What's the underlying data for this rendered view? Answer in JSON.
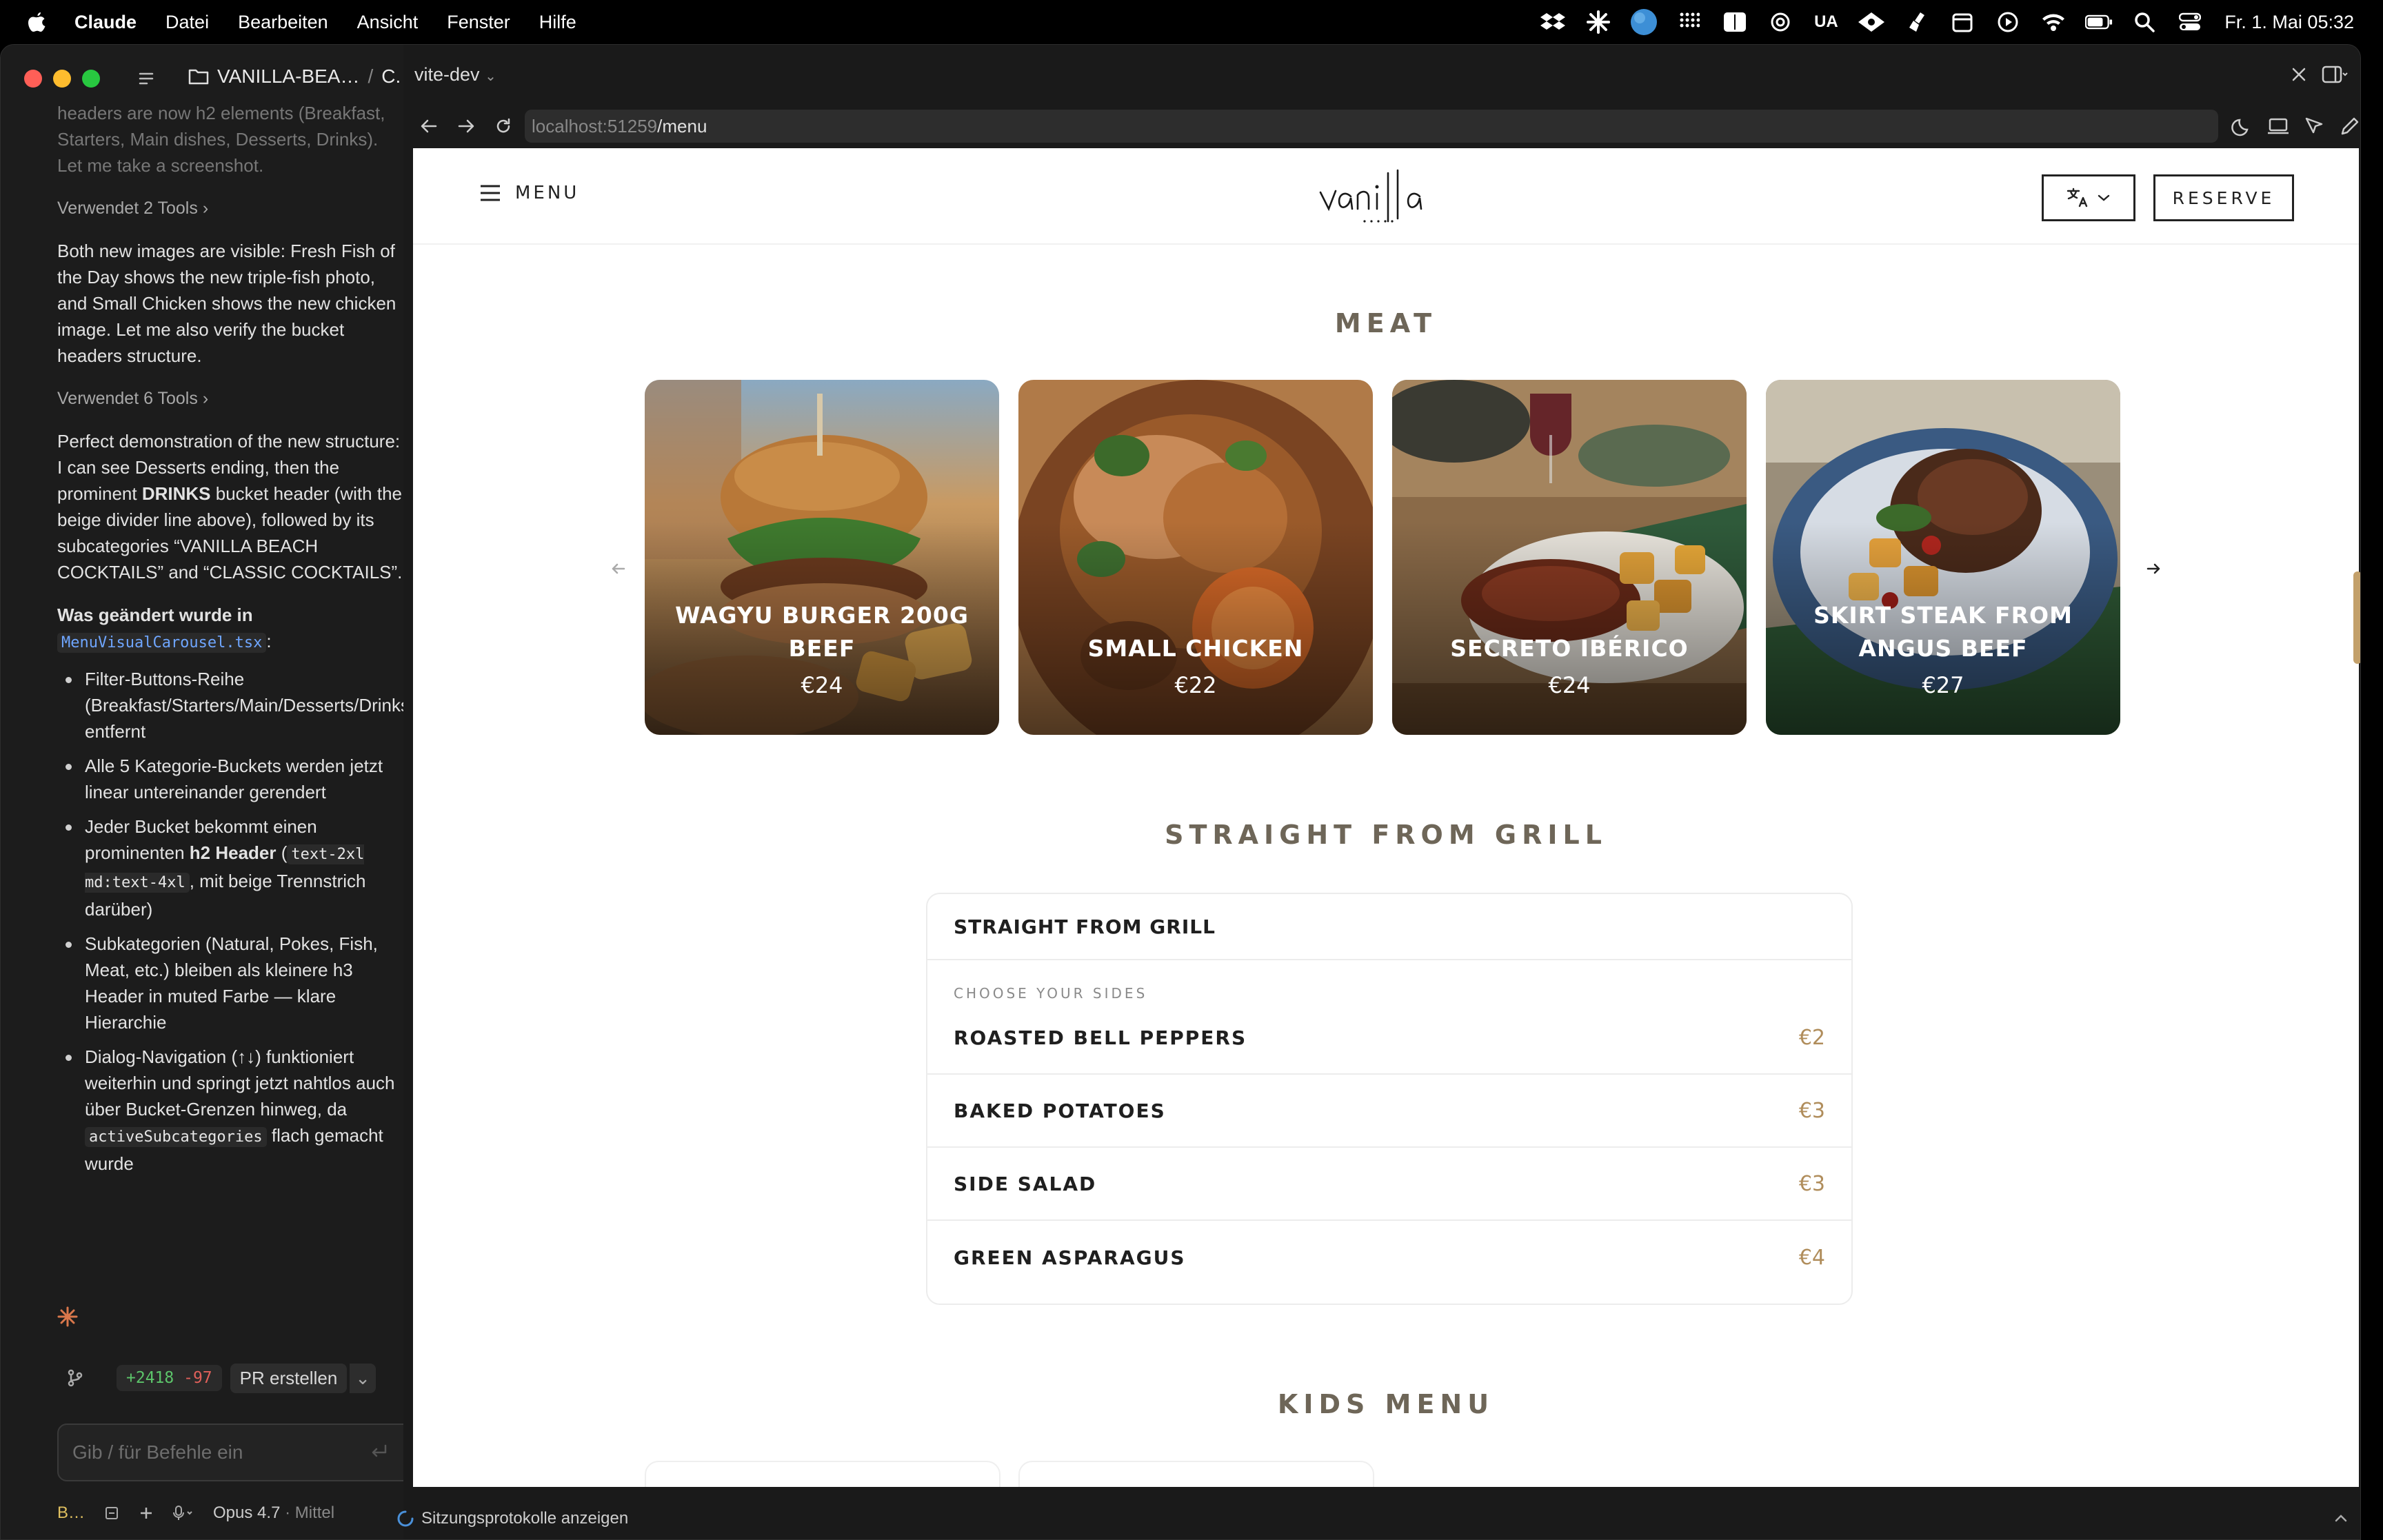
{
  "menubar": {
    "app": "Claude",
    "items": [
      "Datei",
      "Bearbeiten",
      "Ansicht",
      "Fenster",
      "Hilfe"
    ],
    "lang_indicator": "UA",
    "datetime": "Fr. 1. Mai 05:32"
  },
  "chat": {
    "project": "VANILLA-BEA…",
    "project_suffix": "C.",
    "faded_text": "headers are now h2 elements (Breakfast, Starters, Main dishes, Desserts, Drinks). Let me take a screenshot.",
    "tools1": "Verwendet 2 Tools",
    "para1": "Both new images are visible: Fresh Fish of the Day shows the new triple-fish photo, and Small Chicken shows the new chicken image. Let me also verify the bucket headers structure.",
    "tools2": "Verwendet 6 Tools",
    "para2_a": "Perfect demonstration of the new structure: I can see Desserts ending, then the prominent ",
    "para2_bold": "DRINKS",
    "para2_b": " bucket header (with the beige divider line above), followed by its subcategories “VANILLA BEACH COCKTAILS” and “CLASSIC COCKTAILS”.",
    "changed_label": "Was geändert wurde in",
    "changed_file": "MenuVisualCarousel.tsx",
    "colon": ":",
    "bullets": {
      "b1": "Filter-Buttons-Reihe (Breakfast/Starters/Main/Desserts/Drinks) entfernt",
      "b2": "Alle 5 Kategorie-Buckets werden jetzt linear untereinander gerendert",
      "b3_a": "Jeder Bucket bekommt einen prominenten ",
      "b3_bold": "h2 Header",
      "b3_b": " (",
      "b3_code": "text-2xl md:text-4xl",
      "b3_c": ", mit beige Trennstrich darüber)",
      "b4": "Subkategorien (Natural, Pokes, Fish, Meat, etc.) bleiben als kleinere h3 Header in muted Farbe — klare Hierarchie",
      "b5_a": "Dialog-Navigation (↑↓) funktioniert weiterhin und springt jetzt nahtlos auch über Bucket-Grenzen hinweg, da ",
      "b5_code": "activeSubcategories",
      "b5_b": " flach gemacht wurde"
    },
    "diff_add": "+2418",
    "diff_del": "-97",
    "pr_button": "PR erstellen",
    "input_placeholder": "Gib / für Befehle ein",
    "bottom_branch": "B…",
    "bottom_model": "Opus 4.7",
    "bottom_effort": "· Mittel"
  },
  "browser": {
    "tab_name": "vite-dev",
    "url_host": "localhost:51259",
    "url_path": "/menu",
    "status_text": "Sitzungsprotokolle anzeigen"
  },
  "site": {
    "menu_label": "MENU",
    "reserve_label": "RESERVE",
    "meat_title": "MEAT",
    "cards": [
      {
        "name": "WAGYU BURGER 200G BEEF",
        "price": "€24"
      },
      {
        "name": "SMALL CHICKEN",
        "price": "€22"
      },
      {
        "name": "SECRETO IBÉRICO",
        "price": "€24"
      },
      {
        "name": "SKIRT STEAK FROM ANGUS BEEF",
        "price": "€27"
      }
    ],
    "grill_title": "STRAIGHT FROM GRILL",
    "grill_box_title": "STRAIGHT FROM GRILL",
    "sides_label": "CHOOSE YOUR SIDES",
    "sides": [
      {
        "name": "ROASTED BELL PEPPERS",
        "price": "€2"
      },
      {
        "name": "BAKED POTATOES",
        "price": "€3"
      },
      {
        "name": "SIDE SALAD",
        "price": "€3"
      },
      {
        "name": "GREEN ASPARAGUS",
        "price": "€4"
      }
    ],
    "kids_title": "KIDS MENU"
  },
  "colors": {
    "accent_price": "#b08d5b",
    "section_title": "#6e6658",
    "scroll_thumb": "#c3a06a"
  }
}
